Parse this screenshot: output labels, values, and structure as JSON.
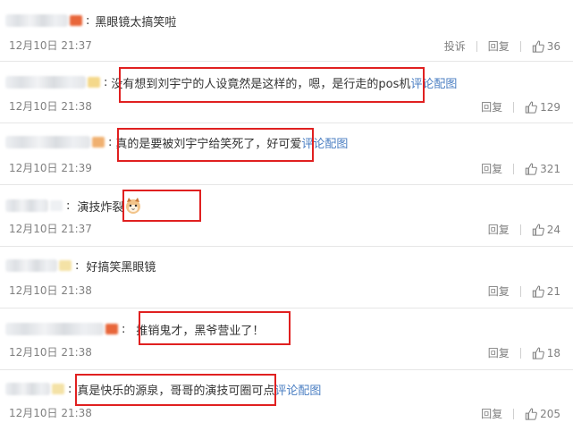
{
  "actions": {
    "report": "投诉",
    "reply": "回复"
  },
  "link_text": "评论配图",
  "comments": [
    {
      "text": "黑眼镜太搞笑啦",
      "time": "12月10日 21:37",
      "likes": "36",
      "has_report": true,
      "has_link": false
    },
    {
      "text": "没有想到刘宇宁的人设竟然是这样的，嗯，是行走的pos机",
      "time": "12月10日 21:38",
      "likes": "129",
      "has_report": false,
      "has_link": true
    },
    {
      "text": "真的是要被刘宇宁给笑死了，好可爱",
      "time": "12月10日 21:39",
      "likes": "321",
      "has_report": false,
      "has_link": true
    },
    {
      "text": "演技炸裂",
      "time": "12月10日 21:37",
      "likes": "24",
      "has_report": false,
      "has_link": false,
      "emoji": "cat-emoji-icon"
    },
    {
      "text": "好搞笑黑眼镜",
      "time": "12月10日 21:38",
      "likes": "21",
      "has_report": false,
      "has_link": false
    },
    {
      "text": "推销鬼才，黑爷营业了！",
      "time": "12月10日 21:38",
      "likes": "18",
      "has_report": false,
      "has_link": false
    },
    {
      "text": "真是快乐的源泉，哥哥的演技可圈可点",
      "time": "12月10日 21:38",
      "likes": "205",
      "has_report": false,
      "has_link": true
    }
  ],
  "colors": {
    "highlight_border": "#e02020",
    "link": "#4a7ec2",
    "meta_text": "#808080"
  }
}
